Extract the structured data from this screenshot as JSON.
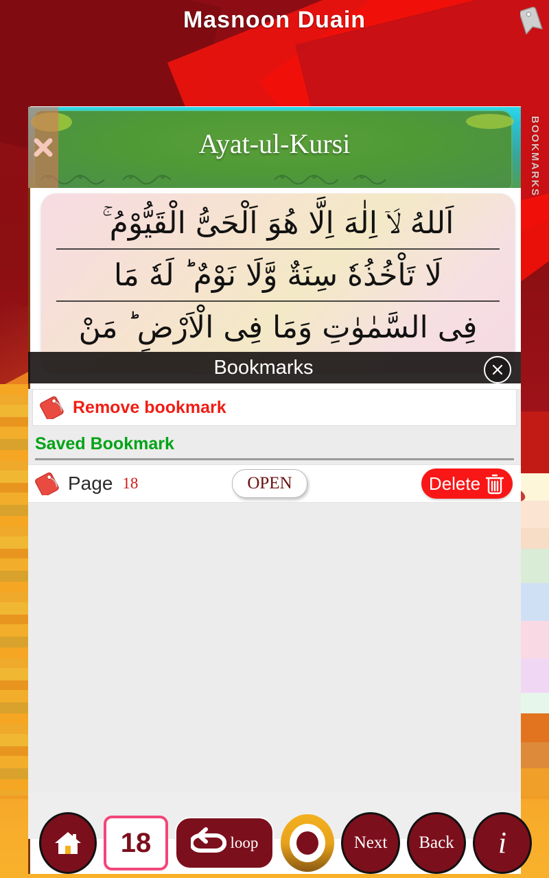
{
  "app": {
    "title": "Masnoon  Duain"
  },
  "reader": {
    "surah_title": "Ayat-ul-Kursi",
    "close_icon": "close-x-icon",
    "banner_tag_icon": "bookmark-tag-icon",
    "bookmarks_rail_label": "BOOKMARKS",
    "ayah_lines": [
      "اَللهُ لَاۤ اِلٰهَ اِلَّا هُوَ اَلْحَىُّ الْقَيُّوْمُ ۚ",
      "لَا تَاْخُذُهٗ سِنَةٌ وَّلَا نَوْمٌ ؕ لَهٗ مَا",
      "فِى السَّمٰوٰتِ وَمَا فِى الْاَرْضِ ؕ مَنْ"
    ]
  },
  "dialog": {
    "title": "Bookmarks",
    "close_icon": "close-circle-icon",
    "remove_bookmark": {
      "label": "Remove bookmark",
      "icon": "bookmark-tag-icon",
      "color": "#f01d15"
    },
    "saved_section_label": "Saved Bookmark",
    "saved_section_color": "#00a316",
    "row": {
      "icon": "bookmark-tag-icon",
      "page_word": "Page",
      "page_number": "18",
      "open_label": "OPEN",
      "delete_label": "Delete",
      "delete_icon": "trash-icon"
    }
  },
  "toolbar": {
    "home_icon": "home-icon",
    "page_number": "18",
    "loop_label": "loop",
    "loop_icon": "loop-arrow-icon",
    "record_icon": "record-circle-icon",
    "next_label": "Next",
    "back_label": "Back",
    "info_label": "i"
  },
  "colors": {
    "brand_maroon": "#7c0f1c",
    "accent_red": "#f91616",
    "accent_green": "#00a316",
    "accent_pink": "#f2467a",
    "amber": "#f6a82a"
  }
}
